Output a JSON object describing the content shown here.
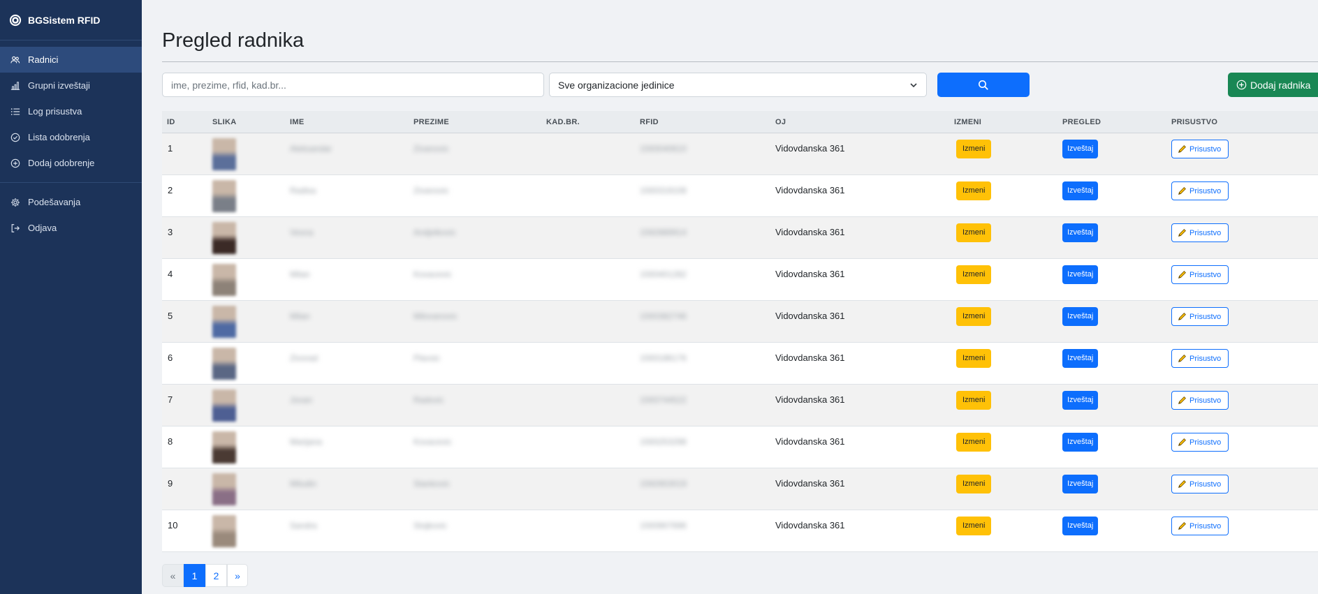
{
  "brand": {
    "name": "BGSistem RFID"
  },
  "sidebar": {
    "items": [
      {
        "label": "Radnici",
        "icon": "users-icon",
        "active": true
      },
      {
        "label": "Grupni izveštaji",
        "icon": "bar-chart-icon"
      },
      {
        "label": "Log prisustva",
        "icon": "list-icon"
      },
      {
        "label": "Lista odobrenja",
        "icon": "check-circle-icon"
      },
      {
        "label": "Dodaj odobrenje",
        "icon": "plus-circle-icon"
      },
      {
        "label": "Podešavanja",
        "icon": "gear-icon"
      },
      {
        "label": "Odjava",
        "icon": "logout-icon"
      }
    ]
  },
  "page": {
    "title": "Pregled radnika"
  },
  "filters": {
    "search_placeholder": "ime, prezime, rfid, kad.br...",
    "search_value": "",
    "org_unit_selected": "Sve organizacione jedinice",
    "add_button_label": "Dodaj radnika"
  },
  "table": {
    "headers": {
      "id": "ID",
      "slika": "SLIKA",
      "ime": "IME",
      "prezime": "PREZIME",
      "kad": "KAD.BR.",
      "rfid": "RFID",
      "oj": "OJ",
      "izmeni": "IZMENI",
      "pregled": "PREGLED",
      "prisustvo": "PRISUSTVO"
    },
    "button_labels": {
      "izmeni": "Izmeni",
      "izvestaj": "Izveštaj",
      "prisustvo": "Prisustvo"
    },
    "rows": [
      {
        "id": "1",
        "ime": "Aleksandar",
        "prezime": "Zivanovic",
        "kad": "",
        "rfid": "1593040610",
        "oj": "Vidovdanska 361",
        "photo_color": "#5b6f9a"
      },
      {
        "id": "2",
        "ime": "Radisa",
        "prezime": "Zivanovic",
        "kad": "",
        "rfid": "1593319108",
        "oj": "Vidovdanska 361",
        "photo_color": "#7a7f88"
      },
      {
        "id": "3",
        "ime": "Vesna",
        "prezime": "Andjelkovic",
        "kad": "",
        "rfid": "1592889914",
        "oj": "Vidovdanska 361",
        "photo_color": "#3b2a26"
      },
      {
        "id": "4",
        "ime": "Milan",
        "prezime": "Kovacevic",
        "kad": "",
        "rfid": "1593401282",
        "oj": "Vidovdanska 361",
        "photo_color": "#8d8278"
      },
      {
        "id": "5",
        "ime": "Milan",
        "prezime": "Milovanovic",
        "kad": "",
        "rfid": "1593382746",
        "oj": "Vidovdanska 361",
        "photo_color": "#4f6aa3"
      },
      {
        "id": "6",
        "ime": "Zivorad",
        "prezime": "Plavsic",
        "kad": "",
        "rfid": "1593186176",
        "oj": "Vidovdanska 361",
        "photo_color": "#5a6784"
      },
      {
        "id": "7",
        "ime": "Jovan",
        "prezime": "Radovic",
        "kad": "",
        "rfid": "1593744522",
        "oj": "Vidovdanska 361",
        "photo_color": "#4e5f93"
      },
      {
        "id": "8",
        "ime": "Marijana",
        "prezime": "Kovacevic",
        "kad": "",
        "rfid": "1593253298",
        "oj": "Vidovdanska 361",
        "photo_color": "#4a3a33"
      },
      {
        "id": "9",
        "ime": "Miludin",
        "prezime": "Stankovic",
        "kad": "",
        "rfid": "1592653019",
        "oj": "Vidovdanska 361",
        "photo_color": "#8a6f86"
      },
      {
        "id": "10",
        "ime": "Sandra",
        "prezime": "Stojkovic",
        "kad": "",
        "rfid": "1593907696",
        "oj": "Vidovdanska 361",
        "photo_color": "#9a8a7c"
      }
    ]
  },
  "pagination": {
    "prev": "«",
    "pages": [
      "1",
      "2"
    ],
    "current": "1",
    "next": "»"
  },
  "colors": {
    "sidebar_bg": "#1c3359",
    "primary": "#0d6efd",
    "warning": "#ffc107",
    "success": "#198754"
  }
}
